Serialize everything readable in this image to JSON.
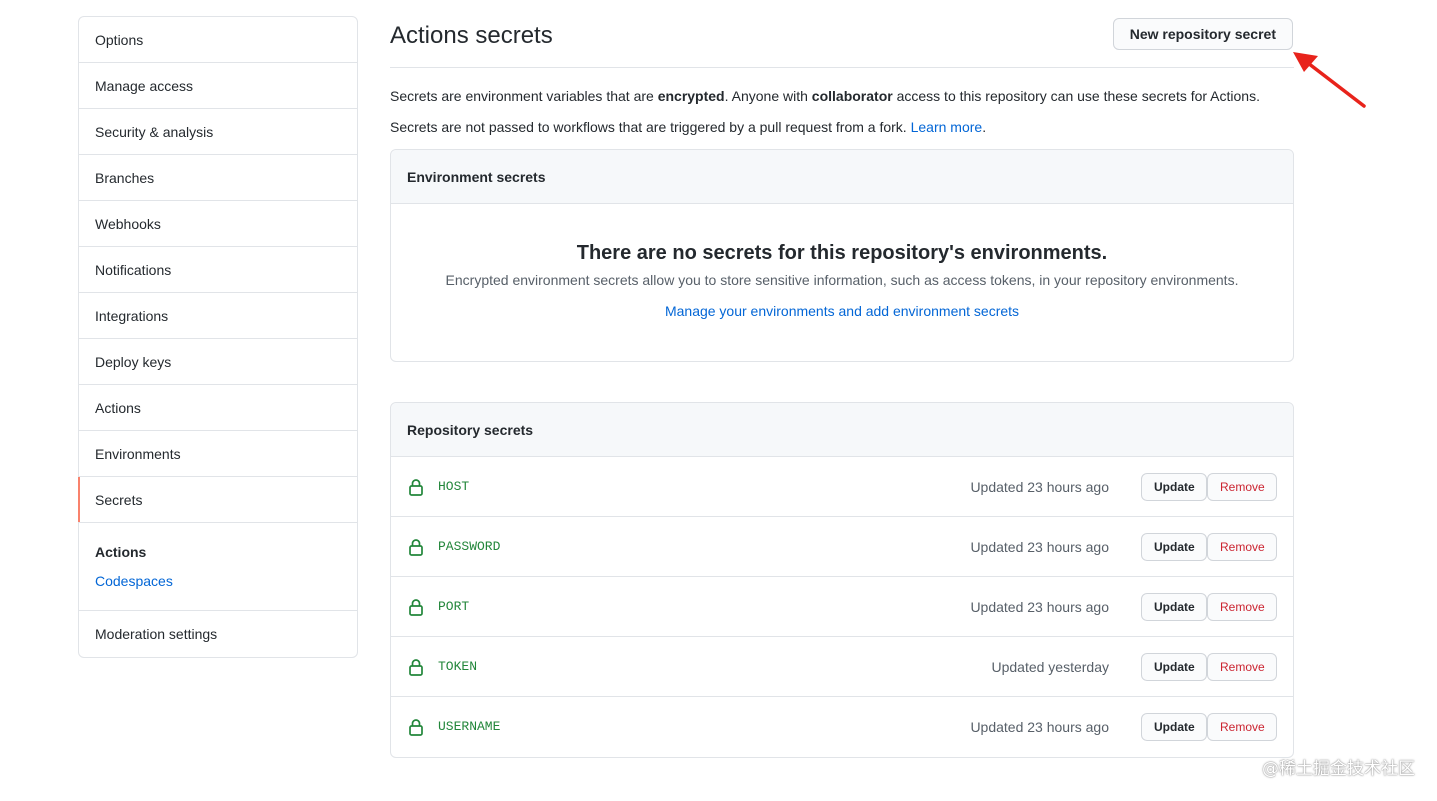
{
  "sidebar": {
    "items": [
      {
        "label": "Options"
      },
      {
        "label": "Manage access"
      },
      {
        "label": "Security & analysis"
      },
      {
        "label": "Branches"
      },
      {
        "label": "Webhooks"
      },
      {
        "label": "Notifications"
      },
      {
        "label": "Integrations"
      },
      {
        "label": "Deploy keys"
      },
      {
        "label": "Actions"
      },
      {
        "label": "Environments"
      },
      {
        "label": "Secrets",
        "selected": true
      }
    ],
    "group": {
      "title": "Actions",
      "link": "Codespaces"
    },
    "bottom_item": "Moderation settings"
  },
  "header": {
    "title": "Actions secrets",
    "new_button": "New repository secret"
  },
  "intro": {
    "line1_part1": "Secrets are environment variables that are ",
    "line1_bold1": "encrypted",
    "line1_part2": ". Anyone with ",
    "line1_bold2": "collaborator",
    "line1_part3": " access to this repository can use these secrets for Actions.",
    "line2_text": "Secrets are not passed to workflows that are triggered by a pull request from a fork. ",
    "line2_link": "Learn more",
    "line2_end": "."
  },
  "env_secrets": {
    "header": "Environment secrets",
    "blank_title": "There are no secrets for this repository's environments.",
    "blank_desc": "Encrypted environment secrets allow you to store sensitive information, such as access tokens, in your repository environments.",
    "blank_link": "Manage your environments and add environment secrets"
  },
  "repo_secrets": {
    "header": "Repository secrets",
    "update_label": "Update",
    "remove_label": "Remove",
    "rows": [
      {
        "name": "HOST",
        "updated": "Updated 23 hours ago"
      },
      {
        "name": "PASSWORD",
        "updated": "Updated 23 hours ago"
      },
      {
        "name": "PORT",
        "updated": "Updated 23 hours ago"
      },
      {
        "name": "TOKEN",
        "updated": "Updated yesterday"
      },
      {
        "name": "USERNAME",
        "updated": "Updated 23 hours ago"
      }
    ]
  },
  "watermark": "@稀土掘金技术社区",
  "colors": {
    "accent_link": "#0366d6",
    "secret_name": "#22863a",
    "remove_text": "#cb2431",
    "selected_marker": "#f9826c",
    "arrow": "#e8231b"
  }
}
